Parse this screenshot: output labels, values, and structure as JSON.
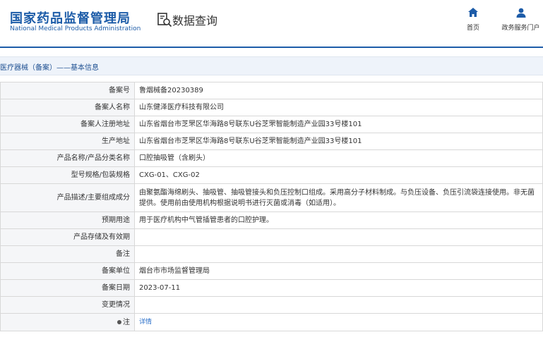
{
  "header": {
    "logo_cn": "国家药品监督管理局",
    "logo_en": "National Medical Products Administration",
    "search_title": "数据查询",
    "nav_home": "首页",
    "nav_gov": "政务服务门户"
  },
  "breadcrumb": {
    "text": "医疗器械（备案）——基本信息"
  },
  "rows": [
    {
      "label": "备案号",
      "value": "鲁烟械备20230389"
    },
    {
      "label": "备案人名称",
      "value": "山东健泽医疗科技有限公司"
    },
    {
      "label": "备案人注册地址",
      "value": "山东省烟台市芝罘区华海路8号联东U谷芝罘智能制造产业园33号楼101"
    },
    {
      "label": "生产地址",
      "value": "山东省烟台市芝罘区华海路8号联东U谷芝罘智能制造产业园33号楼101"
    },
    {
      "label": "产品名称/产品分类名称",
      "value": "口腔抽吸管（含刷头）"
    },
    {
      "label": "型号规格/包装规格",
      "value": "CXG-01、CXG-02"
    },
    {
      "label": "产品描述/主要组成成分",
      "value": "由聚氨酯海绵刷头、抽吸管、抽吸管接头和负压控制口组成。采用高分子材料制成。与负压设备、负压引流袋连接使用。非无菌提供。使用前由使用机构根据说明书进行灭菌或消毒（如适用）。"
    },
    {
      "label": "预期用途",
      "value": "用于医疗机构中气管插管患者的口腔护理。"
    },
    {
      "label": "产品存储及有效期",
      "value": ""
    },
    {
      "label": "备注",
      "value": ""
    },
    {
      "label": "备案单位",
      "value": "烟台市市场监督管理局"
    },
    {
      "label": "备案日期",
      "value": "2023-07-11"
    },
    {
      "label": "变更情况",
      "value": ""
    }
  ],
  "note_row": {
    "label": "注",
    "link": "详情"
  },
  "colors": {
    "brand": "#1d5ca8",
    "link": "#2a6fc9",
    "label_bg": "#f5f6f8",
    "breadcrumb_bg": "#eef3fa"
  },
  "icons": {
    "search": "document-search-icon",
    "home": "home-icon",
    "user": "user-icon",
    "note": "bullet-icon"
  }
}
